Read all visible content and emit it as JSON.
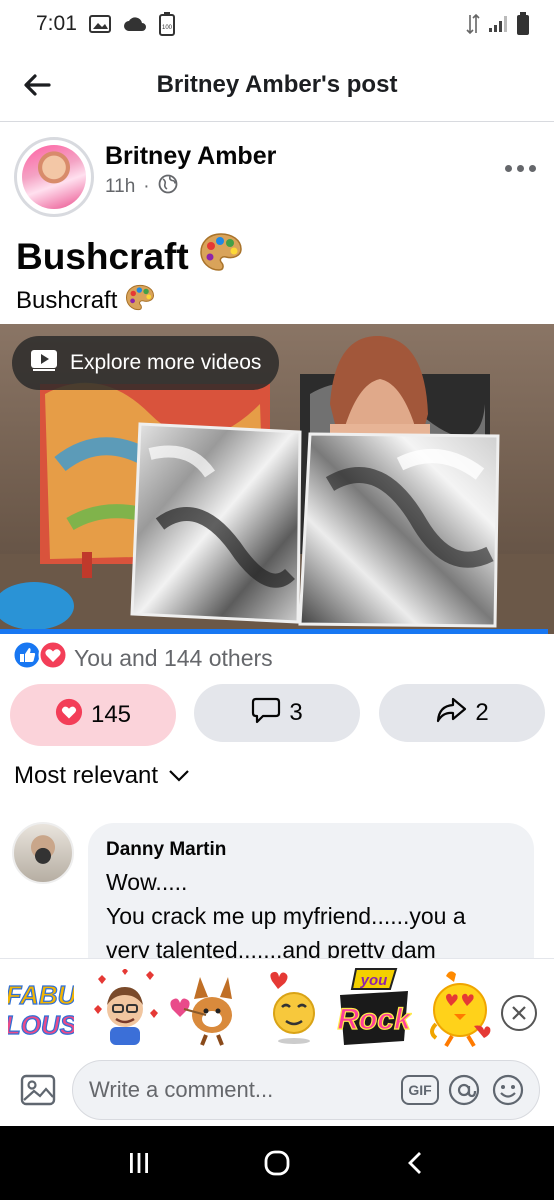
{
  "status_bar": {
    "time": "7:01",
    "notification_icons": [
      "gallery-icon",
      "cloud-icon",
      "battery-saver-icon"
    ],
    "system_icons": [
      "data-transfer-icon",
      "signal-icon",
      "battery-icon"
    ]
  },
  "header": {
    "title": "Britney Amber's post",
    "back_icon": "arrow-left-icon"
  },
  "post": {
    "author": "Britney Amber",
    "time": "11h",
    "separator": "·",
    "privacy_icon": "globe-icon",
    "title": "Bushcraft",
    "subtitle": "Bushcraft",
    "emoji_icon": "artist-palette-icon"
  },
  "video": {
    "explore_label": "Explore more videos",
    "progress": 0.99
  },
  "reactions": {
    "summary": "You and 144 others",
    "icons": [
      "like-icon",
      "love-icon"
    ]
  },
  "actions": {
    "like_count": "145",
    "comment_count": "3",
    "share_count": "2"
  },
  "comments": {
    "sort_label": "Most relevant",
    "items": [
      {
        "author": "Danny Martin",
        "line1": "Wow.....",
        "line2": "You crack me up myfriend......you a",
        "line3": "very talented.......and pretty dam"
      }
    ]
  },
  "stickers": {
    "items": [
      "fabulous-sticker",
      "hearts-face-sticker",
      "cupid-fox-sticker",
      "heart-emoji-sticker",
      "you-rock-sticker",
      "heart-eyes-bird-sticker"
    ],
    "fabulous_text": "FABU LOUS",
    "you_rock_text": "you Rock"
  },
  "composer": {
    "placeholder": "Write a comment...",
    "gif_label": "GIF"
  },
  "colors": {
    "accent": "#1877f2",
    "love": "#f33e58",
    "like_bg": "#fbd3da",
    "button_bg": "#e4e6eb",
    "secondary_text": "#65676b"
  }
}
